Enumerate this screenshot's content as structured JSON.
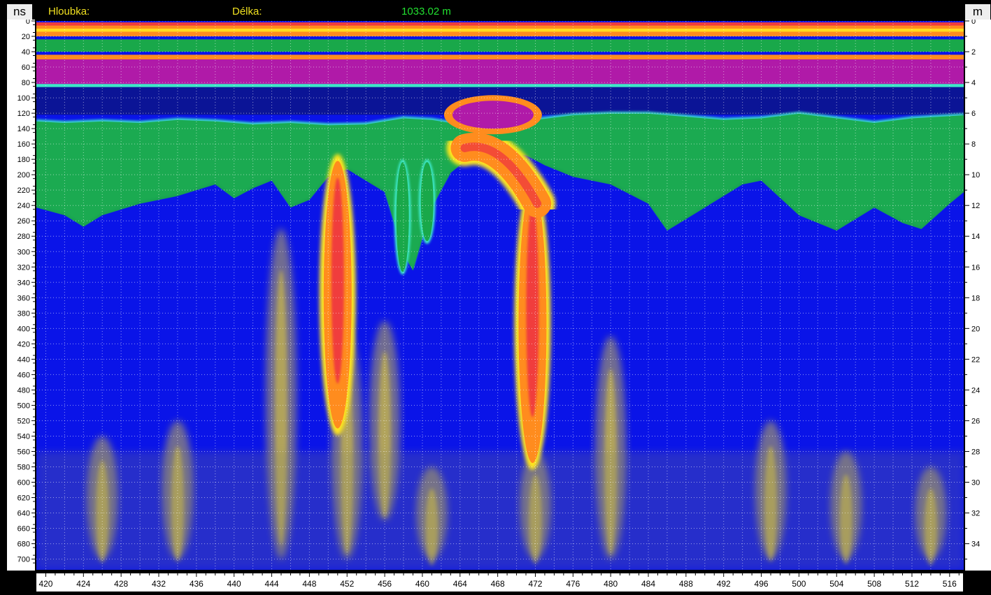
{
  "header": {
    "depth_label": "Hloubka:",
    "length_label": "Délka:",
    "length_value": "1033.02 m",
    "left_unit": "ns",
    "right_unit": "m"
  },
  "colors": {
    "background_blue": "#0a14e8",
    "deep_blue": "#0b1496",
    "green": "#19a84a",
    "cyan": "#3ce8c8",
    "magenta": "#b01aa8",
    "yellow": "#ffe61e",
    "orange": "#ff8c1e",
    "red": "#f03c3c"
  },
  "chart_data": {
    "type": "heatmap",
    "title": "",
    "xlabel": "",
    "ylabel": "ns",
    "y2label": "m",
    "xlim": [
      419,
      517.5
    ],
    "ylim": [
      0,
      714
    ],
    "y2lim": [
      0,
      35.7
    ],
    "x_ticks": [
      420,
      424,
      428,
      432,
      436,
      440,
      444,
      448,
      452,
      456,
      460,
      464,
      468,
      472,
      476,
      480,
      484,
      488,
      492,
      496,
      500,
      504,
      508,
      512,
      516
    ],
    "y_ticks": [
      0,
      20,
      40,
      60,
      80,
      100,
      120,
      140,
      160,
      180,
      200,
      220,
      240,
      260,
      280,
      300,
      320,
      340,
      360,
      380,
      400,
      420,
      440,
      460,
      480,
      500,
      520,
      540,
      560,
      580,
      600,
      620,
      640,
      660,
      680,
      700
    ],
    "y2_ticks": [
      0,
      2,
      4,
      6,
      8,
      10,
      12,
      14,
      16,
      18,
      20,
      22,
      24,
      26,
      28,
      30,
      32,
      34
    ],
    "grid": true,
    "bands": [
      {
        "color": "orange",
        "x": [
          419,
          517.5
        ],
        "y": [
          2,
          20
        ]
      },
      {
        "color": "green",
        "x": [
          419,
          517.5
        ],
        "y": [
          24,
          40
        ]
      },
      {
        "color": "magenta",
        "x": [
          419,
          517.5
        ],
        "y": [
          48,
          84
        ]
      },
      {
        "color": "deep_blue",
        "x": [
          419,
          517.5
        ],
        "y": [
          84,
          122
        ]
      }
    ],
    "layer": [
      [
        419,
        128
      ],
      [
        422,
        130
      ],
      [
        426,
        128
      ],
      [
        430,
        130
      ],
      [
        434,
        126
      ],
      [
        438,
        128
      ],
      [
        442,
        132
      ],
      [
        446,
        130
      ],
      [
        450,
        133
      ],
      [
        454,
        132
      ],
      [
        458,
        124
      ],
      [
        461,
        126
      ],
      [
        464,
        132
      ],
      [
        468,
        130
      ],
      [
        472,
        126
      ],
      [
        476,
        120
      ],
      [
        480,
        118
      ],
      [
        484,
        118
      ],
      [
        488,
        122
      ],
      [
        492,
        126
      ],
      [
        496,
        124
      ],
      [
        500,
        118
      ],
      [
        504,
        124
      ],
      [
        508,
        130
      ],
      [
        512,
        124
      ],
      [
        517.5,
        120
      ]
    ],
    "layer_bottom": [
      [
        419,
        240
      ],
      [
        422,
        250
      ],
      [
        424,
        265
      ],
      [
        426,
        250
      ],
      [
        430,
        235
      ],
      [
        434,
        225
      ],
      [
        438,
        210
      ],
      [
        440,
        228
      ],
      [
        442,
        215
      ],
      [
        444,
        205
      ],
      [
        446,
        240
      ],
      [
        448,
        230
      ],
      [
        450,
        200
      ],
      [
        452,
        190
      ],
      [
        456,
        220
      ],
      [
        458,
        300
      ],
      [
        459,
        322
      ],
      [
        460,
        280
      ],
      [
        461,
        240
      ],
      [
        463,
        195
      ],
      [
        465,
        175
      ],
      [
        468,
        168
      ],
      [
        471,
        172
      ],
      [
        473,
        185
      ],
      [
        476,
        200
      ],
      [
        480,
        210
      ],
      [
        484,
        235
      ],
      [
        486,
        270
      ],
      [
        490,
        240
      ],
      [
        494,
        210
      ],
      [
        496,
        205
      ],
      [
        500,
        250
      ],
      [
        504,
        270
      ],
      [
        508,
        240
      ],
      [
        511,
        260
      ],
      [
        513,
        268
      ],
      [
        516,
        235
      ],
      [
        517.5,
        220
      ]
    ],
    "anomalies": [
      {
        "type": "vertical",
        "x": 451,
        "y": [
          182,
          530
        ],
        "color": "red"
      },
      {
        "type": "vertical",
        "x": 471.7,
        "y": [
          215,
          575
        ],
        "color": "red"
      },
      {
        "type": "arm",
        "x": [
          464.5,
          472.2
        ],
        "y": [
          158,
          245
        ],
        "color": "red"
      },
      {
        "type": "lens",
        "x": 467.5,
        "y": 122,
        "color": "magenta"
      },
      {
        "type": "vertical",
        "x": 457.9,
        "y": [
          180,
          330
        ],
        "color": "green"
      },
      {
        "type": "vertical",
        "x": 460.5,
        "y": [
          180,
          290
        ],
        "color": "green"
      }
    ],
    "diffuse": [
      {
        "x": 445,
        "y": [
          270,
          700
        ]
      },
      {
        "x": 452,
        "y": [
          400,
          700
        ]
      },
      {
        "x": 456,
        "y": [
          390,
          650
        ]
      },
      {
        "x": 461,
        "y": [
          580,
          700
        ]
      },
      {
        "x": 472,
        "y": [
          560,
          700
        ]
      },
      {
        "x": 480,
        "y": [
          410,
          700
        ]
      },
      {
        "x": 434,
        "y": [
          520,
          700
        ]
      },
      {
        "x": 426,
        "y": [
          540,
          700
        ]
      },
      {
        "x": 497,
        "y": [
          520,
          700
        ]
      },
      {
        "x": 505,
        "y": [
          560,
          700
        ]
      },
      {
        "x": 514,
        "y": [
          580,
          700
        ]
      }
    ]
  }
}
